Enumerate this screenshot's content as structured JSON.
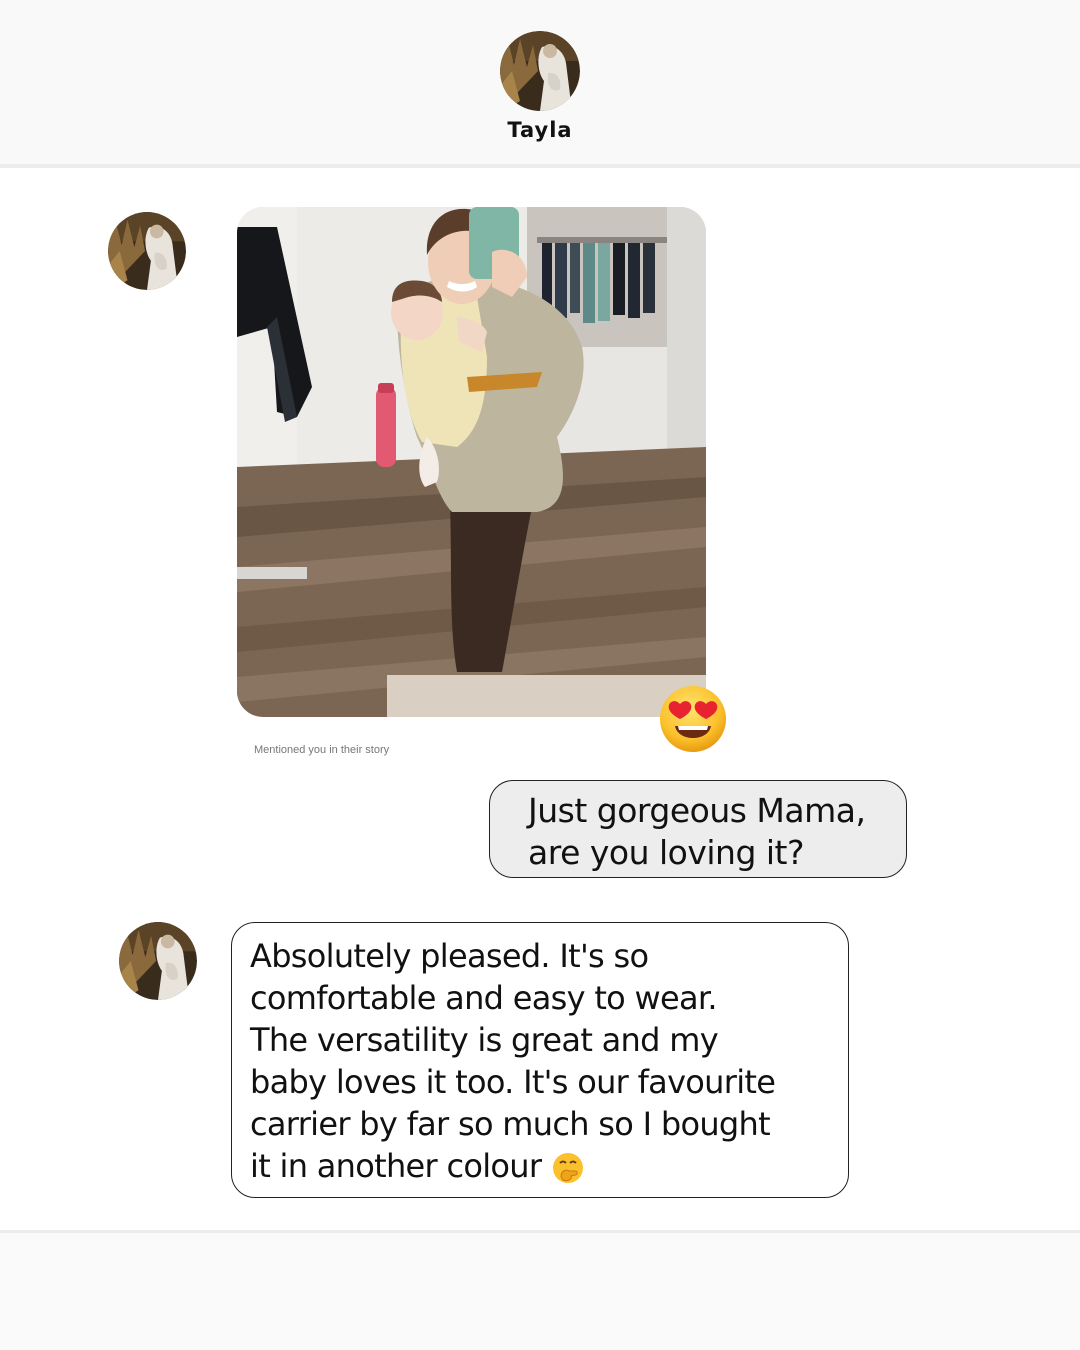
{
  "header": {
    "contact_name": "Tayla",
    "avatar_icon": "profile-photo-avatar"
  },
  "story": {
    "photo_icon": "mirror-selfie-photo",
    "reaction_icon": "heart-eyes-emoji",
    "mention_text": "Mentioned you in their story"
  },
  "messages": {
    "outgoing": {
      "lines": [
        "Just gorgeous Mama,",
        "are you loving it?"
      ]
    },
    "incoming": {
      "lines": [
        "Absolutely pleased. It's so",
        "comfortable and easy to wear.",
        "The versatility is great and my",
        "baby loves it too. It's our favourite",
        "carrier by far so much so I bought",
        "it in another colour"
      ],
      "trailing_icon": "hand-over-mouth-emoji"
    }
  },
  "colors": {
    "outgoing_bubble": "#ededed",
    "incoming_bubble": "#ffffff",
    "bubble_border": "#222222",
    "background": "#fafafa"
  }
}
